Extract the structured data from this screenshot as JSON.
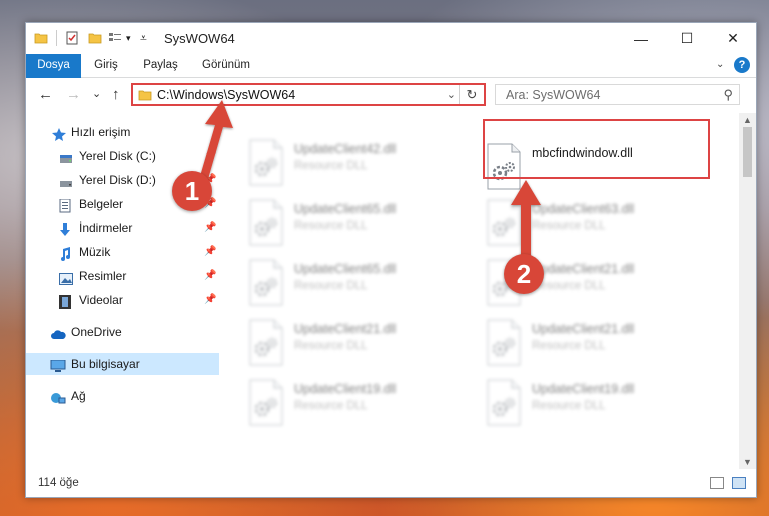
{
  "window": {
    "title": "SysWOW64",
    "minimize_glyph": "—",
    "maximize_glyph": "☐",
    "close_glyph": "✕"
  },
  "ribbon": {
    "tabs": [
      "Dosya",
      "Giriş",
      "Paylaş",
      "Görünüm"
    ],
    "help_glyph": "?"
  },
  "navigation": {
    "back_glyph": "←",
    "forward_glyph": "→",
    "recent_glyph": "⌄",
    "up_glyph": "↑",
    "address_path": "C:\\Windows\\SysWOW64",
    "refresh_glyph": "↻",
    "search_placeholder": "Ara: SysWOW64"
  },
  "sidebar": {
    "items": [
      {
        "label": "Hızlı erişim",
        "icon": "star-icon",
        "pinned": false
      },
      {
        "label": "Yerel Disk (C:)",
        "icon": "drive-icon",
        "pinned": true
      },
      {
        "label": "Yerel Disk (D:)",
        "icon": "drive-icon",
        "pinned": true
      },
      {
        "label": "Belgeler",
        "icon": "documents-icon",
        "pinned": true
      },
      {
        "label": "İndirmeler",
        "icon": "download-icon",
        "pinned": true
      },
      {
        "label": "Müzik",
        "icon": "music-icon",
        "pinned": true
      },
      {
        "label": "Resimler",
        "icon": "pictures-icon",
        "pinned": true
      },
      {
        "label": "Videolar",
        "icon": "videos-icon",
        "pinned": true
      },
      {
        "label": "OneDrive",
        "icon": "cloud-icon",
        "pinned": false
      },
      {
        "label": "Bu bilgisayar",
        "icon": "computer-icon",
        "pinned": false,
        "selected": true
      },
      {
        "label": "Ağ",
        "icon": "network-icon",
        "pinned": false
      }
    ]
  },
  "files": {
    "left_column": [
      {
        "name": "UpdateClient42.dll",
        "type": "Resource DLL"
      },
      {
        "name": "UpdateClient65.dll",
        "type": "Resource DLL"
      },
      {
        "name": "UpdateClient65.dll",
        "type": "Resource DLL"
      },
      {
        "name": "UpdateClient21.dll",
        "type": "Resource DLL"
      },
      {
        "name": "UpdateClient19.dll",
        "type": "Resource DLL"
      }
    ],
    "right_column": [
      {
        "name": "mbcfindwindow.dll",
        "type": ""
      },
      {
        "name": "UpdateClient63.dll",
        "type": "Resource DLL"
      },
      {
        "name": "UpdateClient21.dll",
        "type": "Resource DLL"
      },
      {
        "name": "UpdateClient21.dll",
        "type": "Resource DLL"
      },
      {
        "name": "UpdateClient19.dll",
        "type": "Resource DLL"
      }
    ]
  },
  "status": {
    "item_count": "114 öğe"
  },
  "callouts": [
    "1",
    "2"
  ],
  "colors": {
    "accent": "#1979ca",
    "highlight": "#dd4444",
    "callout": "#d84638",
    "selected": "#cce8ff"
  }
}
